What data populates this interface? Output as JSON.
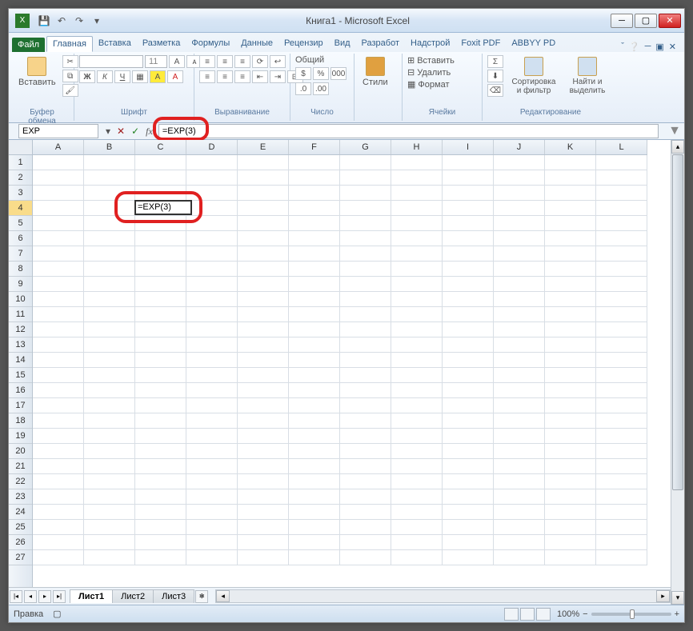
{
  "title": "Книга1 - Microsoft Excel",
  "ribbon": {
    "file": "Файл",
    "tabs": [
      "Главная",
      "Вставка",
      "Разметка",
      "Формулы",
      "Данные",
      "Рецензир",
      "Вид",
      "Разработ",
      "Надстрой",
      "Foxit PDF",
      "ABBYY PD"
    ],
    "active_tab": 0,
    "groups": {
      "clipboard": {
        "label": "Буфер обмена",
        "paste": "Вставить"
      },
      "font": {
        "label": "Шрифт",
        "name": "",
        "size": "11",
        "bold": "Ж",
        "italic": "К",
        "underline": "Ч"
      },
      "alignment": {
        "label": "Выравнивание"
      },
      "number": {
        "label": "Число",
        "format": "Общий"
      },
      "styles": {
        "label": "",
        "btn": "Стили"
      },
      "cells": {
        "label": "Ячейки",
        "insert": "Вставить",
        "delete": "Удалить",
        "format": "Формат"
      },
      "editing": {
        "label": "Редактирование",
        "sort": "Сортировка и фильтр",
        "find": "Найти и выделить"
      }
    }
  },
  "name_box": "EXP",
  "formula": "=EXP(3)",
  "columns": [
    "A",
    "B",
    "C",
    "D",
    "E",
    "F",
    "G",
    "H",
    "I",
    "J",
    "K",
    "L"
  ],
  "row_count": 27,
  "active_row": 4,
  "active_col": 2,
  "cell_value": "=EXP(3)",
  "sheets": [
    "Лист1",
    "Лист2",
    "Лист3"
  ],
  "active_sheet": 0,
  "status_mode": "Правка",
  "zoom": "100%"
}
